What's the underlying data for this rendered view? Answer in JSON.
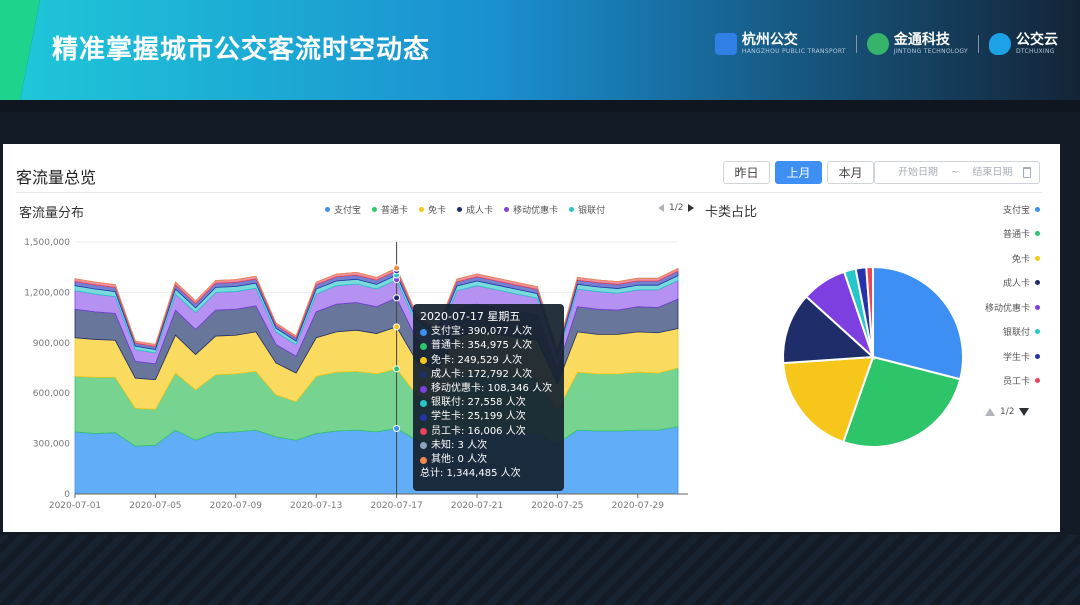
{
  "header": {
    "title": "精准掌握城市公交客流时空动态",
    "logos": [
      {
        "name": "杭州公交",
        "sub": "HANGZHOU PUBLIC TRANSPORT"
      },
      {
        "name": "金通科技",
        "sub": "JINTONG TECHNOLOGY"
      },
      {
        "name": "公交云",
        "sub": "DTCHUXING"
      }
    ]
  },
  "panel": {
    "title": "客流量总览",
    "buttons": [
      {
        "label": "昨日",
        "active": false
      },
      {
        "label": "上月",
        "active": true
      },
      {
        "label": "本月",
        "active": false
      }
    ],
    "date_range": {
      "start_placeholder": "开始日期",
      "separator": "~",
      "end_placeholder": "结束日期"
    },
    "area_title": "客流量分布",
    "legend_pager": "1/2",
    "pie_title": "卡类占比",
    "pie_pager": "1/2"
  },
  "tooltip": {
    "date": "2020-07-17 星期五",
    "rows": [
      {
        "label": "支付宝: 390,077 人次",
        "color": "#3d8ff3"
      },
      {
        "label": "普通卡: 354,975 人次",
        "color": "#2ec46a"
      },
      {
        "label": "免卡: 249,529 人次",
        "color": "#f6c71a"
      },
      {
        "label": "成人卡: 172,792 人次",
        "color": "#1f2e6b"
      },
      {
        "label": "移动优惠卡: 108,346 人次",
        "color": "#7e3fe0"
      },
      {
        "label": "银联付: 27,558 人次",
        "color": "#27c6c8"
      },
      {
        "label": "学生卡: 25,199 人次",
        "color": "#2533a8"
      },
      {
        "label": "员工卡: 16,006 人次",
        "color": "#e8455c"
      },
      {
        "label": "未知: 3 人次",
        "color": "#8fa3c0"
      },
      {
        "label": "其他: 0 人次",
        "color": "#f3894a"
      }
    ],
    "total": "总计: 1,344,485 人次"
  },
  "chart_data": [
    {
      "type": "area",
      "stacked": true,
      "title": "客流量分布",
      "x": [
        "2020-07-01",
        "2020-07-02",
        "2020-07-03",
        "2020-07-04",
        "2020-07-05",
        "2020-07-06",
        "2020-07-07",
        "2020-07-08",
        "2020-07-09",
        "2020-07-10",
        "2020-07-11",
        "2020-07-12",
        "2020-07-13",
        "2020-07-14",
        "2020-07-15",
        "2020-07-16",
        "2020-07-17",
        "2020-07-18",
        "2020-07-19",
        "2020-07-20",
        "2020-07-21",
        "2020-07-22",
        "2020-07-23",
        "2020-07-24",
        "2020-07-25",
        "2020-07-26",
        "2020-07-27",
        "2020-07-28",
        "2020-07-29",
        "2020-07-30",
        "2020-07-31"
      ],
      "x_tick_labels": [
        "2020-07-01",
        "2020-07-05",
        "2020-07-09",
        "2020-07-13",
        "2020-07-17",
        "2020-07-21",
        "2020-07-25",
        "2020-07-29"
      ],
      "y_tick_labels": [
        "0",
        "300,000",
        "600,000",
        "900,000",
        "1,200,000",
        "1,500,000"
      ],
      "ylim": [
        0,
        1500000
      ],
      "series": [
        {
          "name": "支付宝",
          "color": "#5aa9f8",
          "legend_color": "#3d8ff3",
          "values": [
            370000,
            360000,
            365000,
            285000,
            290000,
            380000,
            320000,
            365000,
            370000,
            380000,
            340000,
            320000,
            360000,
            375000,
            380000,
            370000,
            390077,
            320000,
            300000,
            365000,
            380000,
            375000,
            370000,
            360000,
            300000,
            380000,
            375000,
            375000,
            380000,
            380000,
            400000
          ]
        },
        {
          "name": "普通卡",
          "color": "#6fd28a",
          "legend_color": "#2ec46a",
          "values": [
            330000,
            335000,
            330000,
            225000,
            215000,
            340000,
            300000,
            345000,
            345000,
            350000,
            250000,
            230000,
            340000,
            350000,
            350000,
            345000,
            354975,
            270000,
            250000,
            335000,
            345000,
            340000,
            335000,
            330000,
            195000,
            345000,
            340000,
            340000,
            345000,
            340000,
            350000
          ]
        },
        {
          "name": "免卡",
          "color": "#fbd857",
          "legend_color": "#f6c71a",
          "values": [
            230000,
            225000,
            220000,
            180000,
            175000,
            225000,
            210000,
            230000,
            230000,
            235000,
            190000,
            170000,
            230000,
            240000,
            245000,
            240000,
            249529,
            200000,
            185000,
            235000,
            240000,
            235000,
            230000,
            225000,
            160000,
            240000,
            235000,
            235000,
            240000,
            240000,
            235000
          ]
        },
        {
          "name": "成人卡",
          "color": "#5f6f95",
          "legend_color": "#1f2e6b",
          "values": [
            170000,
            165000,
            160000,
            100000,
            95000,
            150000,
            150000,
            155000,
            155000,
            155000,
            110000,
            100000,
            155000,
            165000,
            165000,
            160000,
            172792,
            130000,
            110000,
            165000,
            165000,
            160000,
            155000,
            150000,
            90000,
            150000,
            150000,
            145000,
            150000,
            150000,
            175000
          ]
        },
        {
          "name": "移动优惠卡",
          "color": "#b18cf0",
          "legend_color": "#7e3fe0",
          "values": [
            110000,
            105000,
            100000,
            70000,
            65000,
            95000,
            100000,
            105000,
            105000,
            105000,
            75000,
            70000,
            105000,
            110000,
            110000,
            105000,
            108346,
            90000,
            80000,
            110000,
            110000,
            105000,
            100000,
            100000,
            65000,
            105000,
            105000,
            100000,
            100000,
            105000,
            110000
          ]
        },
        {
          "name": "银联付",
          "color": "#72d8da",
          "legend_color": "#27c6c8",
          "values": [
            30000,
            30000,
            30000,
            20000,
            20000,
            30000,
            28000,
            30000,
            30000,
            30000,
            22000,
            20000,
            30000,
            28000,
            28000,
            28000,
            27558,
            24000,
            22000,
            28000,
            28000,
            28000,
            28000,
            28000,
            20000,
            28000,
            28000,
            28000,
            28000,
            28000,
            30000
          ]
        },
        {
          "name": "学生卡",
          "color": "#6f79cf",
          "legend_color": "#2533a8",
          "values": [
            25000,
            25000,
            25000,
            18000,
            18000,
            25000,
            25000,
            25000,
            25000,
            25000,
            18000,
            18000,
            25000,
            25000,
            25000,
            25000,
            25199,
            20000,
            18000,
            25000,
            25000,
            25000,
            25000,
            25000,
            18000,
            25000,
            25000,
            25000,
            25000,
            25000,
            26000
          ]
        },
        {
          "name": "员工卡",
          "color": "#f08998",
          "legend_color": "#e8455c",
          "values": [
            16000,
            16000,
            16000,
            12000,
            12000,
            16000,
            16000,
            16000,
            16000,
            16000,
            12000,
            12000,
            16000,
            16000,
            16000,
            16000,
            16006,
            14000,
            12000,
            16000,
            16000,
            16000,
            16000,
            16000,
            12000,
            16000,
            16000,
            16000,
            16000,
            16000,
            16000
          ]
        },
        {
          "name": "未知",
          "color": "#aab8cc",
          "legend_color": "#8fa3c0",
          "values": [
            3,
            3,
            3,
            2,
            2,
            3,
            3,
            3,
            3,
            3,
            2,
            2,
            3,
            3,
            3,
            3,
            3,
            2,
            2,
            3,
            3,
            3,
            3,
            3,
            2,
            3,
            3,
            3,
            3,
            3,
            3
          ]
        },
        {
          "name": "其他",
          "color": "#f5a97a",
          "legend_color": "#f3894a",
          "values": [
            0,
            0,
            0,
            0,
            0,
            0,
            0,
            0,
            0,
            0,
            0,
            0,
            0,
            0,
            0,
            0,
            0,
            0,
            0,
            0,
            0,
            0,
            0,
            0,
            0,
            0,
            0,
            0,
            0,
            0,
            0
          ]
        }
      ],
      "legend_visible": [
        "支付宝",
        "普通卡",
        "免卡",
        "成人卡",
        "移动优惠卡",
        "银联付"
      ],
      "tooltip_index": 16
    },
    {
      "type": "pie",
      "title": "卡类占比",
      "slices": [
        {
          "name": "支付宝",
          "value": 29,
          "color": "#3d8ff3"
        },
        {
          "name": "普通卡",
          "value": 26.4,
          "color": "#2ec46a"
        },
        {
          "name": "免卡",
          "value": 18.6,
          "color": "#f6c71a"
        },
        {
          "name": "成人卡",
          "value": 12.8,
          "color": "#1f2e6b"
        },
        {
          "name": "移动优惠卡",
          "value": 8.1,
          "color": "#7e3fe0"
        },
        {
          "name": "银联付",
          "value": 2.1,
          "color": "#27c6c8"
        },
        {
          "name": "学生卡",
          "value": 1.9,
          "color": "#2533a8"
        },
        {
          "name": "员工卡",
          "value": 1.2,
          "color": "#e8455c"
        }
      ],
      "legend_position": "right"
    }
  ]
}
